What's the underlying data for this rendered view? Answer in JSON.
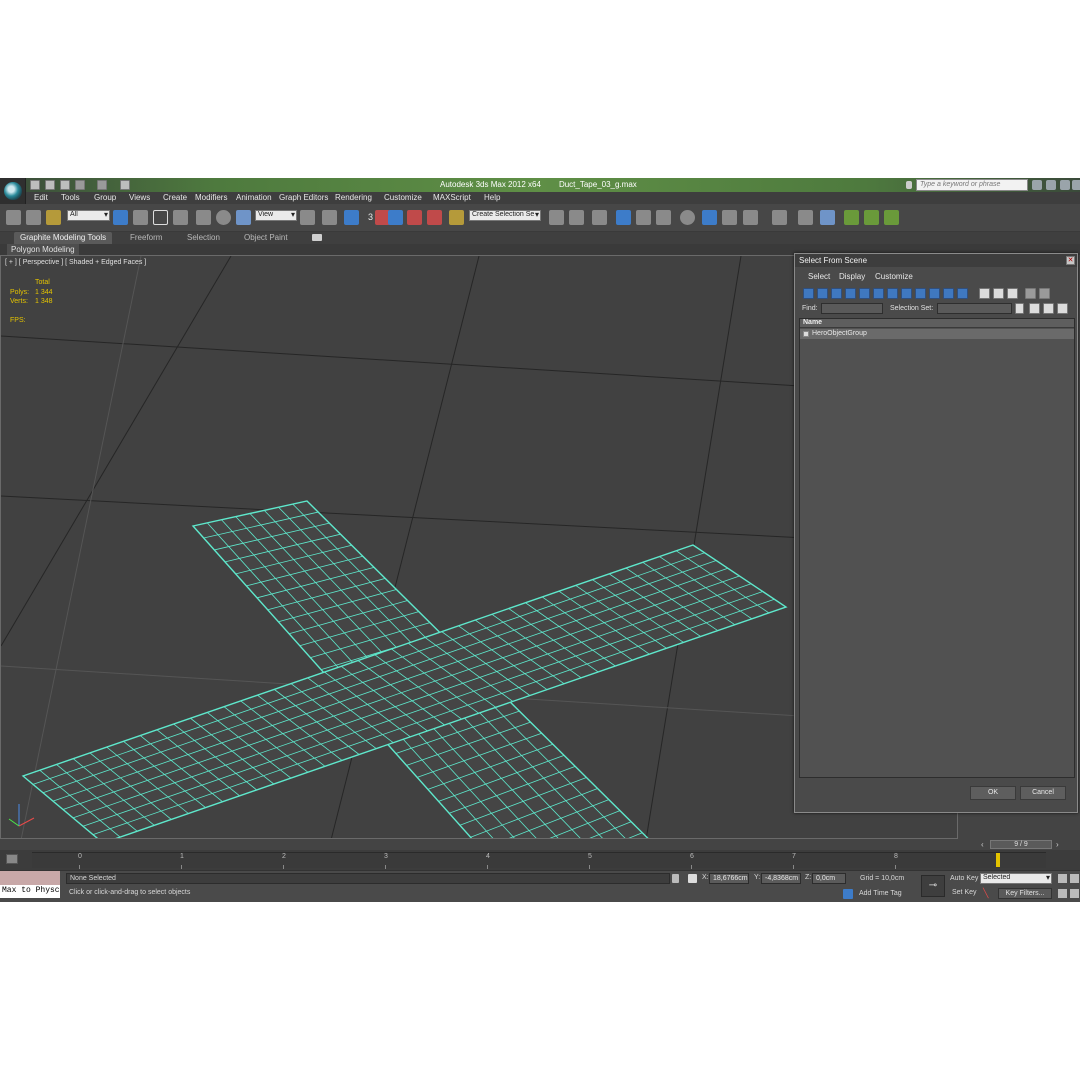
{
  "window": {
    "app_title": "Autodesk 3ds Max  2012 x64",
    "file_name": "Duct_Tape_03_g.max",
    "search_placeholder": "Type a keyword or phrase"
  },
  "menu": [
    "Edit",
    "Tools",
    "Group",
    "Views",
    "Create",
    "Modifiers",
    "Animation",
    "Graph Editors",
    "Rendering",
    "Customize",
    "MAXScript",
    "Help"
  ],
  "toolbar": {
    "selection_filter": "All",
    "reference_coord": "View",
    "named_selection_placeholder": "Create Selection Se",
    "snap_label": "3"
  },
  "ribbon": {
    "tabs": [
      "Graphite Modeling Tools",
      "Freeform",
      "Selection",
      "Object Paint"
    ],
    "active_tab": "Graphite Modeling Tools",
    "panel": "Polygon Modeling"
  },
  "viewport": {
    "label": "[ + ] [ Perspective ] [ Shaded + Edged Faces ]",
    "stats_header": "Total",
    "polys_label": "Polys:",
    "polys_value": "1 344",
    "verts_label": "Verts:",
    "verts_value": "1 348",
    "fps_label": "FPS:",
    "wire_color": "#5ee8cc",
    "bg_color": "#414141"
  },
  "dialog": {
    "title": "Select From Scene",
    "menu": [
      "Select",
      "Display",
      "Customize"
    ],
    "find_label": "Find:",
    "selection_set_label": "Selection Set:",
    "column_name": "Name",
    "items": [
      "HeroObjectGroup"
    ],
    "ok": "OK",
    "cancel": "Cancel"
  },
  "timeline": {
    "frame_display": "9 / 9",
    "ticks": [
      "0",
      "1",
      "2",
      "3",
      "4",
      "5",
      "6",
      "7",
      "8"
    ]
  },
  "status": {
    "maxscript_text": "Max to Physc",
    "selection": "None Selected",
    "prompt": "Click or click-and-drag to select objects",
    "x_label": "X:",
    "x_value": "18,6766cm",
    "y_label": "Y:",
    "y_value": "-4,8368cm",
    "z_label": "Z:",
    "z_value": "0,0cm",
    "grid": "Grid = 10,0cm",
    "add_time_tag": "Add Time Tag",
    "auto_key": "Auto Key",
    "auto_key_mode": "Selected",
    "set_key": "Set Key",
    "key_filters": "Key Filters..."
  }
}
